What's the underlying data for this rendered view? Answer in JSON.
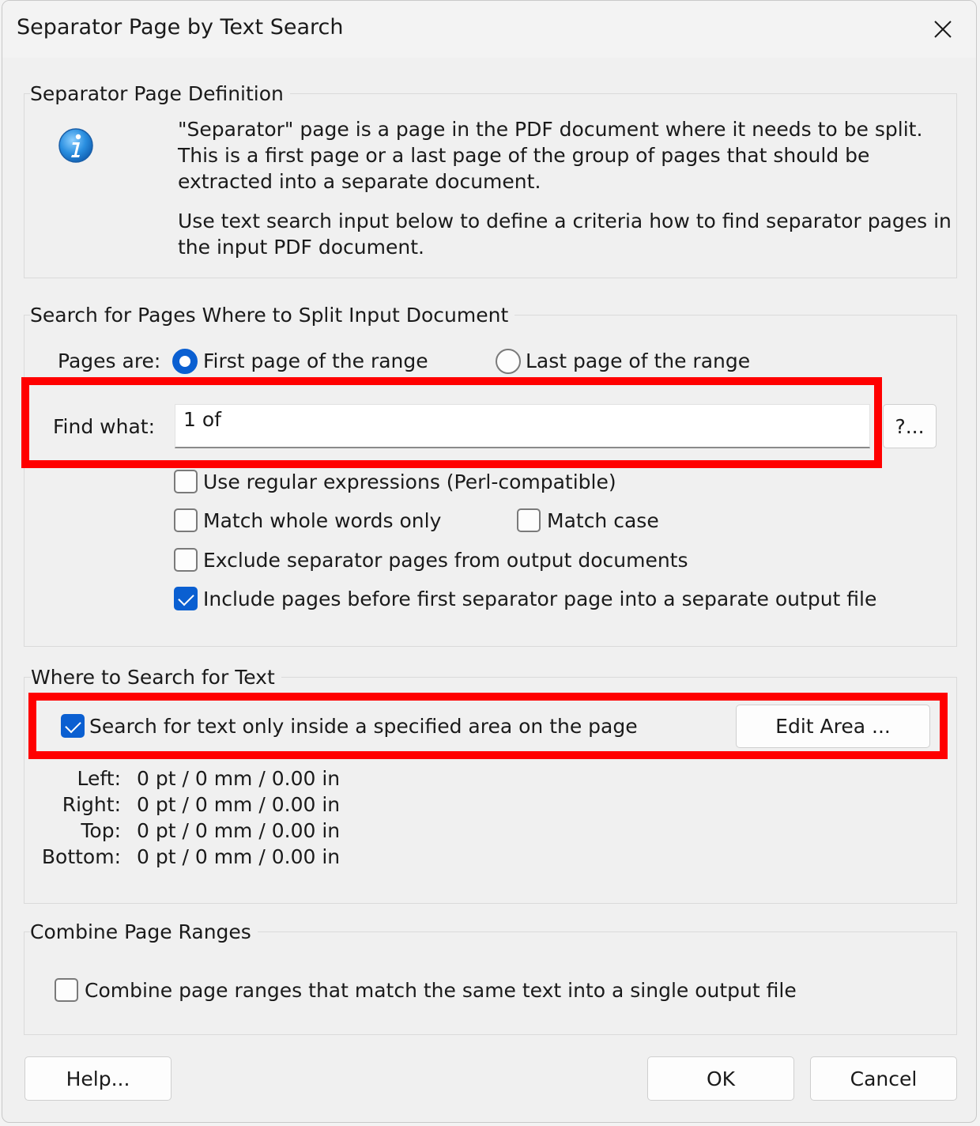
{
  "dialog": {
    "title": "Separator Page by Text Search"
  },
  "definition": {
    "group_title": "Separator Page Definition",
    "para1_line1": "\"Separator\" page is a page in the PDF document where it needs to be split.",
    "para1_line2": "This is a first page or a last page of the group of pages that should be",
    "para1_line3": "extracted into a separate document.",
    "para2_line1": "Use text search input below to define a criteria how to find separator pages in",
    "para2_line2": "the input PDF document."
  },
  "search": {
    "group_title": "Search for Pages Where to Split Input Document",
    "pages_are_label": "Pages are:",
    "radio_first": {
      "label": "First page of the range",
      "checked": true
    },
    "radio_last": {
      "label": "Last page of the range",
      "checked": false
    },
    "find_what_label": "Find what:",
    "find_what_value": "1 of",
    "help_button": "?...",
    "regex": {
      "label": "Use regular expressions (Perl-compatible)",
      "checked": false
    },
    "whole_words": {
      "label": "Match whole words only",
      "checked": false
    },
    "match_case": {
      "label": "Match case",
      "checked": false
    },
    "exclude_separator": {
      "label": "Exclude separator pages from output documents",
      "checked": false
    },
    "include_before": {
      "label": "Include pages before first separator page into a separate output file",
      "checked": true
    }
  },
  "where": {
    "group_title": "Where to Search for Text",
    "area_only": {
      "label": "Search for text only inside a specified area on the page",
      "checked": true
    },
    "edit_area_button": "Edit Area ...",
    "left_label": "Left:",
    "left_value": "0 pt / 0 mm / 0.00 in",
    "right_label": "Right:",
    "right_value": "0 pt / 0 mm / 0.00 in",
    "top_label": "Top:",
    "top_value": "0 pt / 0 mm / 0.00 in",
    "bottom_label": "Bottom:",
    "bottom_value": "0 pt / 0 mm / 0.00 in"
  },
  "combine": {
    "group_title": "Combine Page Ranges",
    "combine_ranges": {
      "label": "Combine page ranges that match the same text into a single output file",
      "checked": false
    }
  },
  "buttons": {
    "help": "Help...",
    "ok": "OK",
    "cancel": "Cancel"
  },
  "colors": {
    "accent": "#0a5fd1",
    "highlight": "#ff0000",
    "info_icon": "#2a8fe0"
  }
}
